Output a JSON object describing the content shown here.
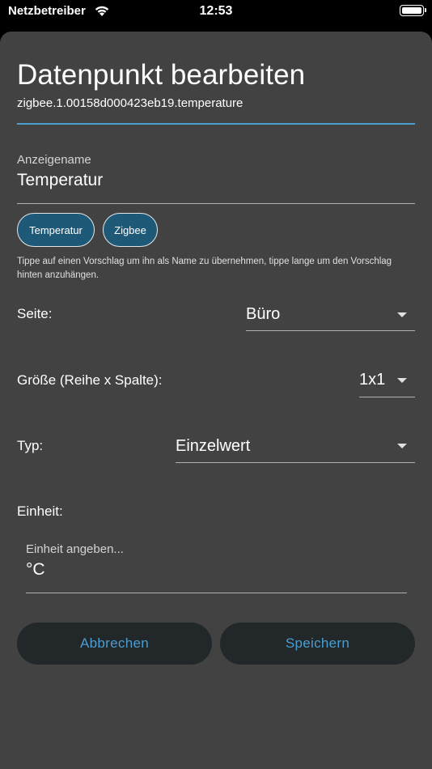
{
  "status_bar": {
    "carrier": "Netzbetreiber",
    "time": "12:53"
  },
  "dialog": {
    "title": "Datenpunkt bearbeiten",
    "subtitle": "zigbee.1.00158d000423eb19.temperature"
  },
  "display_name": {
    "label": "Anzeigename",
    "value": "Temperatur"
  },
  "suggestions": [
    "Temperatur",
    "Zigbee"
  ],
  "hint": "Tippe auf einen Vorschlag um ihn als Name zu übernehmen, tippe lange um den Vorschlag hinten anzuhängen.",
  "page_select": {
    "label": "Seite:",
    "value": "Büro"
  },
  "size_select": {
    "label": "Größe (Reihe x Spalte):",
    "value": "1x1"
  },
  "type_select": {
    "label": "Typ:",
    "value": "Einzelwert"
  },
  "unit": {
    "label": "Einheit:",
    "placeholder": "Einheit angeben...",
    "value": "°C"
  },
  "actions": {
    "cancel": "Abbrechen",
    "save": "Speichern"
  },
  "colors": {
    "accent": "#4a9fd0",
    "sheet": "#424242",
    "chip": "#1e5a78",
    "button": "#22272a"
  }
}
